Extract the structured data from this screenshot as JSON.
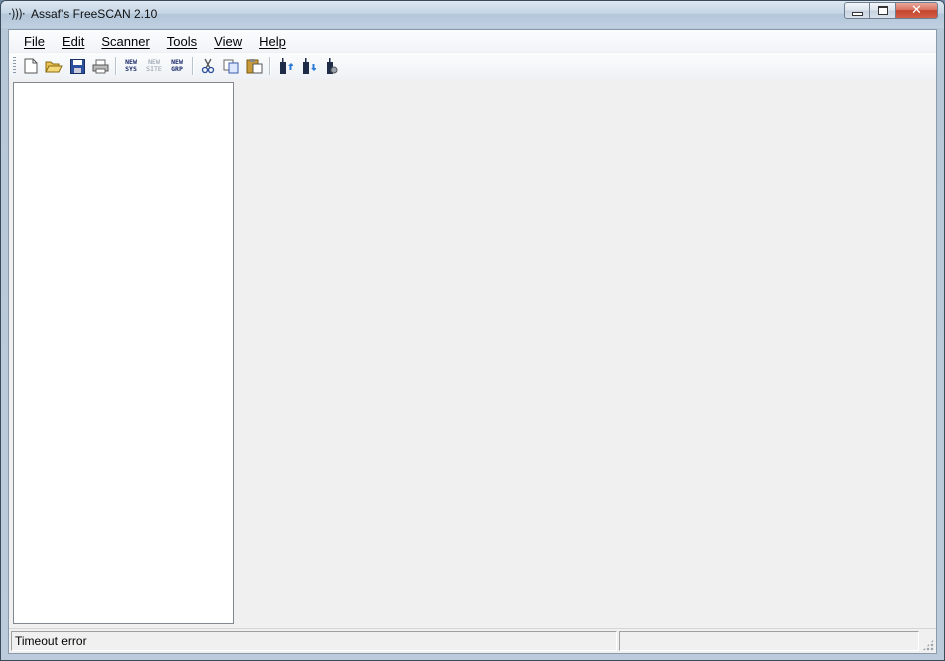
{
  "window": {
    "app_icon": "·)))·",
    "title": "Assaf's FreeSCAN 2.10",
    "close_symbol": "✕"
  },
  "menu": {
    "items": [
      {
        "label": "File"
      },
      {
        "label": "Edit"
      },
      {
        "label": "Scanner"
      },
      {
        "label": "Tools"
      },
      {
        "label": "View"
      },
      {
        "label": "Help"
      }
    ]
  },
  "toolbar": {
    "icons": {
      "new": "new-document-icon",
      "open": "open-folder-icon",
      "save": "save-floppy-icon",
      "print": "printer-icon",
      "cut": "scissors-icon",
      "copy": "copy-icon",
      "paste": "paste-clipboard-icon",
      "upload": "radio-upload-icon",
      "download": "radio-download-icon",
      "settings": "radio-settings-icon"
    },
    "new_sys": {
      "line1": "NEW",
      "line2": "SYS"
    },
    "new_site": {
      "line1": "NEW",
      "line2": "SITE"
    },
    "new_grp": {
      "line1": "NEW",
      "line2": "GRP"
    }
  },
  "statusbar": {
    "message": "Timeout error",
    "secondary": ""
  },
  "colors": {
    "client_bg": "#f0f0f0",
    "tree_bg": "#ffffff",
    "close_button": "#c3442c"
  }
}
